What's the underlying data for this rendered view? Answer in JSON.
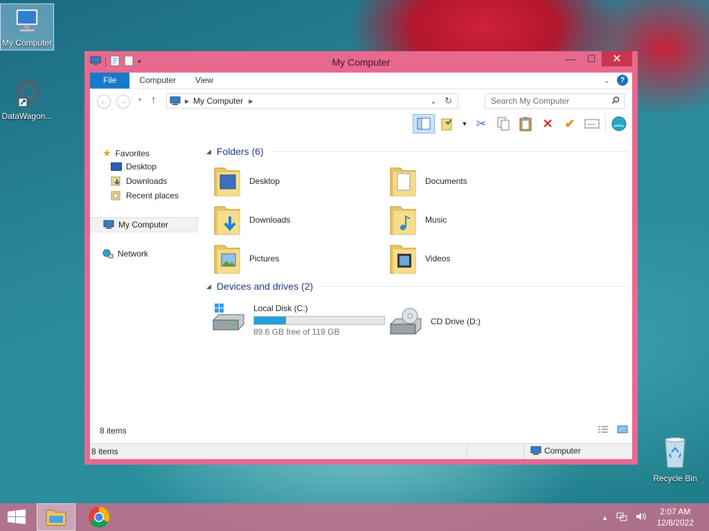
{
  "desktop": {
    "icons": [
      {
        "label": "My Computer"
      },
      {
        "label": "DataWagon..."
      },
      {
        "label": "Recycle Bin"
      }
    ]
  },
  "window": {
    "title": "My Computer",
    "ribbon_tabs": [
      "File",
      "Computer",
      "View"
    ],
    "address": {
      "crumb": "My Computer"
    },
    "search_placeholder": "Search My Computer",
    "nav": {
      "favorites": "Favorites",
      "desktop": "Desktop",
      "downloads": "Downloads",
      "recent": "Recent places",
      "my_computer": "My Computer",
      "network": "Network"
    },
    "groups": {
      "folders": "Folders (6)",
      "devices": "Devices and drives (2)"
    },
    "folders": [
      {
        "name": "Desktop"
      },
      {
        "name": "Documents"
      },
      {
        "name": "Downloads"
      },
      {
        "name": "Music"
      },
      {
        "name": "Pictures"
      },
      {
        "name": "Videos"
      }
    ],
    "drives": [
      {
        "name": "Local Disk (C:)",
        "free_text": "89.6 GB free of 119 GB",
        "used_fraction": 0.247
      },
      {
        "name": "CD Drive (D:)"
      }
    ],
    "item_count": "8 items",
    "status": {
      "left": "8 items",
      "right": "Computer"
    }
  },
  "taskbar": {
    "time": "2:07 AM",
    "date": "12/8/2022"
  },
  "colors": {
    "window_frame": "#e7698e",
    "file_tab": "#1979ca",
    "drive_bar": "#26a0da",
    "group_header": "#1e3287"
  }
}
